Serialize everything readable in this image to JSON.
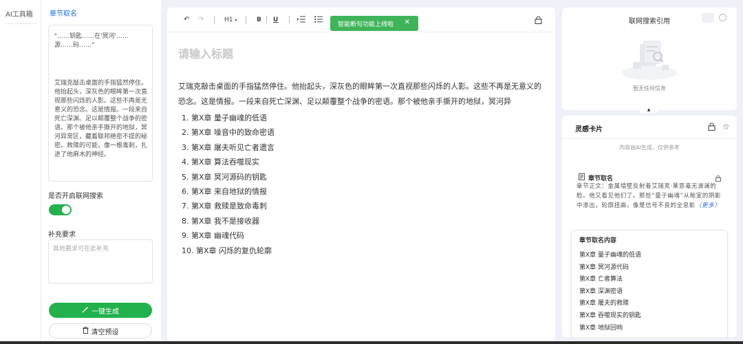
{
  "sidebar": {
    "title": "AI工具箱"
  },
  "config": {
    "heading": "章节取名",
    "quote": "\"……钥匙……在'冥河'……源……码……\"",
    "paragraph": "艾瑞克敲击桌面的手指猛然停住。他抬起头，深灰色的眼眸第一次直视那些闪烁的人影。这些不再是无意义的恐念。这是情报。一段来自死亡深渊、足以颠覆整个战争的密语。那个被他亲手撕开的地狱，冥河异常区，藏着联邦绝密不提的秘密。救赎的可能，像一根毒刺，扎进了他麻木的神经。",
    "web_search_label": "是否开启联网搜索",
    "web_search_on": true,
    "extra_label": "补充要求",
    "extra_placeholder": "其他要求可在此补充",
    "generate_label": "一键生成",
    "clear_label": "清空预设"
  },
  "toolbar": {
    "heading_label": "H1",
    "bold_label": "B",
    "underline_label": "U"
  },
  "toast": {
    "message": "智能断句功能上线啦",
    "close_label": "✕"
  },
  "editor": {
    "title_placeholder": "请输入标题",
    "body": "艾瑞克敲击桌面的手指猛然停住。他抬起头，深灰色的眼眸第一次直视那些闪烁的人影。这些不再是无意义的恐念。这是情报。一段来自死亡深渊、足以颠覆整个战争的密语。那个被他亲手撕开的地狱，冥河异",
    "chapters": [
      "1. 第X章 量子幽魂的低语",
      "2. 第X章 噪音中的致命密语",
      "3. 第X章 屠夫听见亡者遗言",
      "4. 第X章 算法吞噬现实",
      "5. 第X章 冥河源码的钥匙",
      "6. 第X章 来自地狱的情报",
      "7. 第X章 救赎是致命毒刺",
      "8. 第X章 我不是接收器",
      "9. 第X章 幽魂代码",
      "10. 第X章 闪烁的复仇轮廓"
    ]
  },
  "search_panel": {
    "title": "联网搜索引用",
    "empty_text": "暂无任何信息"
  },
  "inspiration": {
    "title": "灵感卡片",
    "note": "内容由AI生成，仅供参考",
    "card_title": "章节取名",
    "card_body": "章节正文：金属墙壁反射着艾瑞克·莱恩毫无波澜的脸。他又看见他们了。那些“量子幽魂”从舱室的阴影中渗出，轮廓扭曲，像是信号不良的全息影",
    "card_more": "（更多）",
    "content_title": "章节取名内容",
    "content_items": [
      "第X章 量子幽魂的低语",
      "第X章 冥河源代码",
      "第X章 亡者算法",
      "第X章 深渊密语",
      "第X章 屠夫的救赎",
      "第X章 吞噬现实的钥匙",
      "第X章 地狱回响"
    ]
  }
}
